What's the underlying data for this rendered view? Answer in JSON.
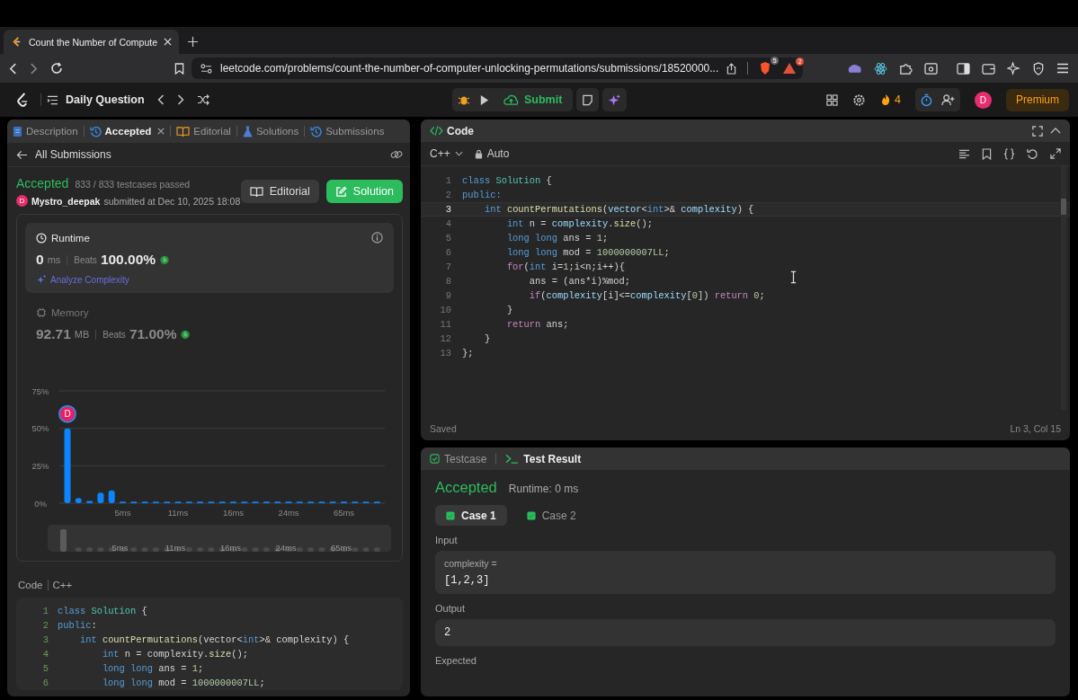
{
  "browser": {
    "tab": {
      "title": "Count the Number of Compute",
      "selected": true
    },
    "url": "leetcode.com/problems/count-the-number-of-computer-unlocking-permutations/submissions/18520000...",
    "shield_badge": "5",
    "alert_badge": "2"
  },
  "nav": {
    "daily": "Daily Question",
    "submit": "Submit",
    "streak": "4",
    "avatar": "D",
    "premium": "Premium"
  },
  "left": {
    "tabs": [
      {
        "label": "Description",
        "selected": false,
        "closable": false
      },
      {
        "label": "Accepted",
        "selected": true,
        "closable": true
      },
      {
        "label": "Editorial",
        "selected": false,
        "closable": false
      },
      {
        "label": "Solutions",
        "selected": false,
        "closable": false
      },
      {
        "label": "Submissions",
        "selected": false,
        "closable": false
      }
    ],
    "back": "All Submissions",
    "status": "Accepted",
    "passed": "833 / 833 testcases passed",
    "avatar": "D",
    "user": "Mystro_deepak",
    "submitted": "submitted at Dec 10, 2025 18:08",
    "buttons": [
      {
        "label": "Editorial",
        "kind": "secondary"
      },
      {
        "label": "Solution",
        "kind": "primary"
      }
    ],
    "stats": [
      {
        "kind": "runtime",
        "title": "Runtime",
        "value": "0",
        "unit": "ms",
        "beats_label": "Beats",
        "beats": "100.00%",
        "selected": true,
        "link": "Analyze Complexity"
      },
      {
        "kind": "memory",
        "title": "Memory",
        "value": "92.71",
        "unit": "MB",
        "beats_label": "Beats",
        "beats": "71.00%",
        "selected": false
      }
    ],
    "chart_data": {
      "type": "bar",
      "categories": [
        null,
        null,
        null,
        null,
        null,
        "5ms",
        null,
        null,
        null,
        null,
        "11ms",
        null,
        null,
        null,
        null,
        "16ms",
        null,
        null,
        null,
        null,
        "24ms",
        null,
        null,
        null,
        null,
        "65ms",
        null,
        null,
        null
      ],
      "values": [
        50,
        3.5,
        1.5,
        7,
        8.5,
        1,
        1,
        1,
        1,
        1,
        1,
        1,
        1,
        1,
        1,
        1,
        1,
        1,
        1,
        1,
        1,
        1,
        1,
        1,
        1,
        1,
        1,
        1,
        1
      ],
      "ylim": [
        0,
        75
      ],
      "yticks": [
        {
          "value": 0,
          "label": "0%"
        },
        {
          "value": 25,
          "label": "25%"
        },
        {
          "value": 50,
          "label": "50%"
        },
        {
          "value": 75,
          "label": "75%"
        }
      ],
      "annotations": [
        "D"
      ]
    },
    "overview": {
      "labels": [
        "5ms",
        "11ms",
        "16ms",
        "24ms",
        "65ms"
      ]
    },
    "code_label": "Code",
    "code_lang": "C++",
    "code": [
      {
        "num": "1",
        "tokens": [
          {
            "text": "class ",
            "kind": "kw"
          },
          {
            "text": "Solution",
            "kind": "cls"
          },
          {
            "text": " {",
            "kind": "p"
          }
        ]
      },
      {
        "num": "2",
        "tokens": [
          {
            "text": "public",
            "kind": "kw"
          },
          {
            "text": ":",
            "kind": "p"
          }
        ]
      },
      {
        "num": "3",
        "tokens": [
          {
            "text": "    int ",
            "kind": "kw"
          },
          {
            "text": "countPermutations",
            "kind": "fn"
          },
          {
            "text": "(vector<",
            "kind": "p"
          },
          {
            "text": "int",
            "kind": "kw"
          },
          {
            "text": ">& complexity) {",
            "kind": "p"
          }
        ]
      },
      {
        "num": "4",
        "tokens": [
          {
            "text": "        int ",
            "kind": "kw"
          },
          {
            "text": "n = complexity.",
            "kind": "p"
          },
          {
            "text": "size",
            "kind": "fn"
          },
          {
            "text": "();",
            "kind": "p"
          }
        ]
      },
      {
        "num": "5",
        "tokens": [
          {
            "text": "        long long ",
            "kind": "kw"
          },
          {
            "text": "ans = ",
            "kind": "p"
          },
          {
            "text": "1",
            "kind": "num"
          },
          {
            "text": ";",
            "kind": "p"
          }
        ]
      },
      {
        "num": "6",
        "tokens": [
          {
            "text": "        long long ",
            "kind": "kw"
          },
          {
            "text": "mod = ",
            "kind": "p"
          },
          {
            "text": "1000000007LL",
            "kind": "num"
          },
          {
            "text": ";",
            "kind": "p"
          }
        ]
      }
    ]
  },
  "editor": {
    "title": "Code",
    "lang": "C++",
    "mode": "Auto",
    "status": "Saved",
    "cursor": "Ln 3, Col 15",
    "lines": [
      {
        "num": "1",
        "active": false,
        "tokens": [
          {
            "text": "class ",
            "kind": "kw"
          },
          {
            "text": "Solution",
            "kind": "cls"
          },
          {
            "text": " {",
            "kind": "p"
          }
        ]
      },
      {
        "num": "2",
        "active": false,
        "tokens": [
          {
            "text": "public:",
            "kind": "kw"
          }
        ]
      },
      {
        "num": "3",
        "active": true,
        "tokens": [
          {
            "text": "    int ",
            "kind": "kw"
          },
          {
            "text": "countPermutations",
            "kind": "fn"
          },
          {
            "text": "(",
            "kind": "p"
          },
          {
            "text": "vector",
            "kind": "var"
          },
          {
            "text": "<",
            "kind": "p"
          },
          {
            "text": "int",
            "kind": "kw"
          },
          {
            "text": ">& ",
            "kind": "p"
          },
          {
            "text": "complexity",
            "kind": "var"
          },
          {
            "text": ") {",
            "kind": "p"
          }
        ]
      },
      {
        "num": "4",
        "active": false,
        "tokens": [
          {
            "text": "        int ",
            "kind": "kw"
          },
          {
            "text": "n = ",
            "kind": "p"
          },
          {
            "text": "complexity",
            "kind": "var"
          },
          {
            "text": ".",
            "kind": "p"
          },
          {
            "text": "size",
            "kind": "fn"
          },
          {
            "text": "();",
            "kind": "p"
          }
        ]
      },
      {
        "num": "5",
        "active": false,
        "tokens": [
          {
            "text": "        long long ",
            "kind": "kw"
          },
          {
            "text": "ans = ",
            "kind": "p"
          },
          {
            "text": "1",
            "kind": "num"
          },
          {
            "text": ";",
            "kind": "p"
          }
        ]
      },
      {
        "num": "6",
        "active": false,
        "tokens": [
          {
            "text": "        long long ",
            "kind": "kw"
          },
          {
            "text": "mod = ",
            "kind": "p"
          },
          {
            "text": "1000000007LL",
            "kind": "num"
          },
          {
            "text": ";",
            "kind": "p"
          }
        ]
      },
      {
        "num": "7",
        "active": false,
        "tokens": [
          {
            "text": "        for",
            "kind": "ctl"
          },
          {
            "text": "(",
            "kind": "p"
          },
          {
            "text": "int ",
            "kind": "kw"
          },
          {
            "text": "i=",
            "kind": "p"
          },
          {
            "text": "1",
            "kind": "num"
          },
          {
            "text": ";i<n;i++){",
            "kind": "p"
          }
        ]
      },
      {
        "num": "8",
        "active": false,
        "tokens": [
          {
            "text": "            ans = (ans*i)%mod;",
            "kind": "p"
          }
        ]
      },
      {
        "num": "9",
        "active": false,
        "tokens": [
          {
            "text": "            if",
            "kind": "ctl"
          },
          {
            "text": "(",
            "kind": "p"
          },
          {
            "text": "complexity",
            "kind": "var"
          },
          {
            "text": "[i]<=",
            "kind": "p"
          },
          {
            "text": "complexity",
            "kind": "var"
          },
          {
            "text": "[",
            "kind": "p"
          },
          {
            "text": "0",
            "kind": "num"
          },
          {
            "text": "]) ",
            "kind": "p"
          },
          {
            "text": "return ",
            "kind": "ctl"
          },
          {
            "text": "0",
            "kind": "num"
          },
          {
            "text": ";",
            "kind": "p"
          }
        ]
      },
      {
        "num": "10",
        "active": false,
        "tokens": [
          {
            "text": "        }",
            "kind": "p"
          }
        ]
      },
      {
        "num": "11",
        "active": false,
        "tokens": [
          {
            "text": "        return ",
            "kind": "ctl"
          },
          {
            "text": "ans;",
            "kind": "p"
          }
        ]
      },
      {
        "num": "12",
        "active": false,
        "tokens": [
          {
            "text": "    }",
            "kind": "p"
          }
        ]
      },
      {
        "num": "13",
        "active": false,
        "tokens": [
          {
            "text": "};",
            "kind": "p"
          }
        ]
      }
    ]
  },
  "results": {
    "tabs": [
      {
        "label": "Testcase",
        "selected": false
      },
      {
        "label": "Test Result",
        "selected": true
      }
    ],
    "status": "Accepted",
    "runtime": "Runtime: 0 ms",
    "cases": [
      {
        "label": "Case 1",
        "selected": true,
        "passed": true
      },
      {
        "label": "Case 2",
        "selected": false,
        "passed": true
      }
    ],
    "input_label": "Input",
    "input_name": "complexity =",
    "input_value": "[1,2,3]",
    "output_label": "Output",
    "output_value": "2",
    "expected_label": "Expected"
  }
}
